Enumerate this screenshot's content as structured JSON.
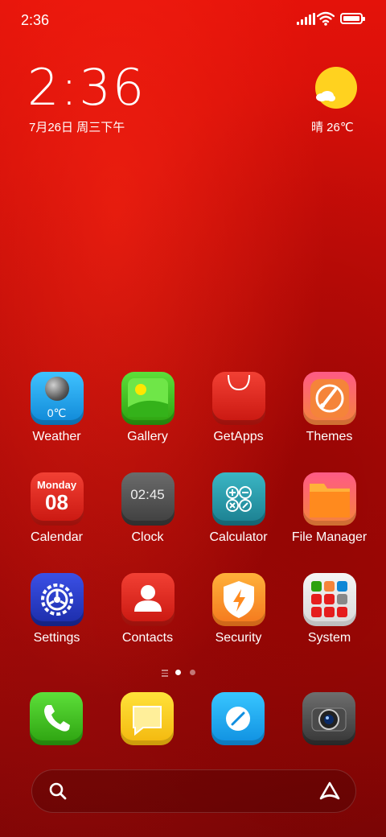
{
  "status_bar": {
    "time": "2:36",
    "icons": [
      "signal-icon",
      "wifi-icon",
      "battery-icon"
    ]
  },
  "clock_widget": {
    "time": "2:36",
    "date": "7月26日 周三下午"
  },
  "weather_widget": {
    "condition_temp": "晴 26℃",
    "icon": "sunny-cloud-icon"
  },
  "apps": [
    {
      "label": "Weather",
      "icon": "weather-icon",
      "detail": "0℃"
    },
    {
      "label": "Gallery",
      "icon": "gallery-icon"
    },
    {
      "label": "GetApps",
      "icon": "getapps-icon"
    },
    {
      "label": "Themes",
      "icon": "themes-icon"
    },
    {
      "label": "Calendar",
      "icon": "calendar-icon",
      "day": "Monday",
      "date": "08"
    },
    {
      "label": "Clock",
      "icon": "clock-icon",
      "time": "02:45"
    },
    {
      "label": "Calculator",
      "icon": "calculator-icon"
    },
    {
      "label": "File Manager",
      "icon": "file-manager-icon"
    },
    {
      "label": "Settings",
      "icon": "settings-icon"
    },
    {
      "label": "Contacts",
      "icon": "contacts-icon"
    },
    {
      "label": "Security",
      "icon": "security-icon"
    },
    {
      "label": "System",
      "icon": "system-folder-icon"
    }
  ],
  "page_indicator": {
    "pages": 2,
    "current": 1
  },
  "dock": [
    "phone-icon",
    "messages-icon",
    "browser-icon",
    "camera-icon"
  ],
  "search_bar": {
    "icons": [
      "search-icon",
      "assistant-icon"
    ]
  },
  "colors": {
    "wallpaper": "#c70d08",
    "sun": "#ffd21f"
  }
}
